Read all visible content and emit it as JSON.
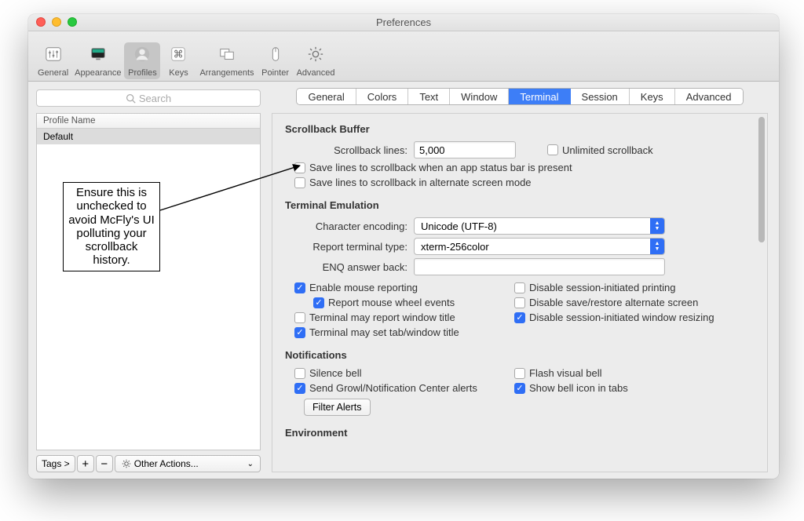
{
  "window_title": "Preferences",
  "toolbar": [
    {
      "label": "General",
      "icon": "slider"
    },
    {
      "label": "Appearance",
      "icon": "monitor"
    },
    {
      "label": "Profiles",
      "icon": "person",
      "active": true
    },
    {
      "label": "Keys",
      "icon": "command"
    },
    {
      "label": "Arrangements",
      "icon": "windows"
    },
    {
      "label": "Pointer",
      "icon": "mouse"
    },
    {
      "label": "Advanced",
      "icon": "gear"
    }
  ],
  "sidebar": {
    "search_placeholder": "Search",
    "column_header": "Profile Name",
    "rows": [
      "Default"
    ],
    "footer": {
      "tags": "Tags >",
      "plus": "+",
      "minus": "−",
      "other": "Other Actions..."
    }
  },
  "tabs": [
    "General",
    "Colors",
    "Text",
    "Window",
    "Terminal",
    "Session",
    "Keys",
    "Advanced"
  ],
  "tabs_active_index": 4,
  "sections": {
    "scrollback": {
      "heading": "Scrollback Buffer",
      "lines_label": "Scrollback lines:",
      "lines_value": "5,000",
      "unlimited": "Unlimited scrollback",
      "save_statusbar": "Save lines to scrollback when an app status bar is present",
      "save_altscreen": "Save lines to scrollback in alternate screen mode"
    },
    "emulation": {
      "heading": "Terminal Emulation",
      "encoding_label": "Character encoding:",
      "encoding_value": "Unicode (UTF-8)",
      "termtype_label": "Report terminal type:",
      "termtype_value": "xterm-256color",
      "enq_label": "ENQ answer back:",
      "enq_value": "",
      "left_checks": [
        {
          "label": "Enable mouse reporting",
          "checked": true
        },
        {
          "label": "Report mouse wheel events",
          "checked": true,
          "indent": true
        },
        {
          "label": "Terminal may report window title",
          "checked": false
        },
        {
          "label": "Terminal may set tab/window title",
          "checked": true
        }
      ],
      "right_checks": [
        {
          "label": "Disable session-initiated printing",
          "checked": false
        },
        {
          "label": "Disable save/restore alternate screen",
          "checked": false
        },
        {
          "label": "Disable session-initiated window resizing",
          "checked": true
        }
      ]
    },
    "notifications": {
      "heading": "Notifications",
      "left": [
        {
          "label": "Silence bell",
          "checked": false
        },
        {
          "label": "Send Growl/Notification Center alerts",
          "checked": true
        }
      ],
      "right": [
        {
          "label": "Flash visual bell",
          "checked": false
        },
        {
          "label": "Show bell icon in tabs",
          "checked": true
        }
      ],
      "filter_button": "Filter Alerts"
    },
    "environment": {
      "heading": "Environment"
    }
  },
  "callout_text": "Ensure this is unchecked to avoid McFly's UI polluting your scrollback history."
}
